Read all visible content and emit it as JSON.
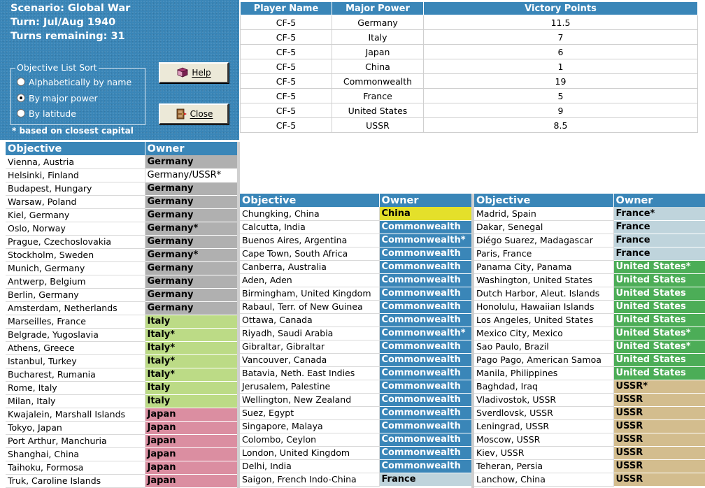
{
  "scenario": {
    "line1": "Scenario: Global War",
    "line2": "Turn: Jul/Aug 1940",
    "line3": "Turns remaining: 31"
  },
  "sort": {
    "legend": "Objective List Sort",
    "options": [
      "Alphabetically by name",
      "By major power",
      "By latitude"
    ],
    "selected": "By major power",
    "note": "* based on closest capital"
  },
  "buttons": {
    "help": "Help",
    "close": "Close"
  },
  "victory_table": {
    "headers": [
      "Player Name",
      "Major Power",
      "Victory Points"
    ],
    "rows": [
      [
        "CF-5",
        "Germany",
        "11.5"
      ],
      [
        "CF-5",
        "Italy",
        "7"
      ],
      [
        "CF-5",
        "Japan",
        "6"
      ],
      [
        "CF-5",
        "China",
        "1"
      ],
      [
        "CF-5",
        "Commonwealth",
        "19"
      ],
      [
        "CF-5",
        "France",
        "5"
      ],
      [
        "CF-5",
        "United States",
        "9"
      ],
      [
        "CF-5",
        "USSR",
        "8.5"
      ]
    ]
  },
  "objective_headers": {
    "objective": "Objective",
    "owner": "Owner"
  },
  "owner_colors": {
    "Germany": "#b0b0b0",
    "Italy": "#bcdb86",
    "Japan": "#db8ea1",
    "China": "#e4e02a",
    "Commonwealth": "#3a86b8",
    "France": "#bfd4dc",
    "United States": "#4cad57",
    "USSR": "#d3bd8e"
  },
  "objectives_left": [
    {
      "name": "Vienna, Austria",
      "owner": "Germany",
      "cls": "o-germany"
    },
    {
      "name": "Helsinki, Finland",
      "owner": "Germany/USSR*",
      "cls": "o-plain"
    },
    {
      "name": "Budapest, Hungary",
      "owner": "Germany",
      "cls": "o-germany"
    },
    {
      "name": "Warsaw, Poland",
      "owner": "Germany",
      "cls": "o-germany"
    },
    {
      "name": "Kiel, Germany",
      "owner": "Germany",
      "cls": "o-germany"
    },
    {
      "name": "Oslo, Norway",
      "owner": "Germany*",
      "cls": "o-germany"
    },
    {
      "name": "Prague, Czechoslovakia",
      "owner": "Germany",
      "cls": "o-germany"
    },
    {
      "name": "Stockholm, Sweden",
      "owner": "Germany*",
      "cls": "o-germany"
    },
    {
      "name": "Munich, Germany",
      "owner": "Germany",
      "cls": "o-germany"
    },
    {
      "name": "Antwerp, Belgium",
      "owner": "Germany",
      "cls": "o-germany"
    },
    {
      "name": "Berlin, Germany",
      "owner": "Germany",
      "cls": "o-germany"
    },
    {
      "name": "Amsterdam, Netherlands",
      "owner": "Germany",
      "cls": "o-germany"
    },
    {
      "name": "Marseilles, France",
      "owner": "Italy",
      "cls": "o-italy"
    },
    {
      "name": "Belgrade, Yugoslavia",
      "owner": "Italy*",
      "cls": "o-italy"
    },
    {
      "name": "Athens, Greece",
      "owner": "Italy*",
      "cls": "o-italy"
    },
    {
      "name": "Istanbul, Turkey",
      "owner": "Italy*",
      "cls": "o-italy"
    },
    {
      "name": "Bucharest, Rumania",
      "owner": "Italy*",
      "cls": "o-italy"
    },
    {
      "name": "Rome, Italy",
      "owner": "Italy",
      "cls": "o-italy"
    },
    {
      "name": "Milan, Italy",
      "owner": "Italy",
      "cls": "o-italy"
    },
    {
      "name": "Kwajalein, Marshall Islands",
      "owner": "Japan",
      "cls": "o-japan"
    },
    {
      "name": "Tokyo, Japan",
      "owner": "Japan",
      "cls": "o-japan"
    },
    {
      "name": "Port Arthur, Manchuria",
      "owner": "Japan",
      "cls": "o-japan"
    },
    {
      "name": "Shanghai, China",
      "owner": "Japan",
      "cls": "o-japan"
    },
    {
      "name": "Taihoku, Formosa",
      "owner": "Japan",
      "cls": "o-japan"
    },
    {
      "name": "Truk, Caroline Islands",
      "owner": "Japan",
      "cls": "o-japan"
    }
  ],
  "objectives_middle": [
    {
      "name": "Chungking, China",
      "owner": "China",
      "cls": "o-china"
    },
    {
      "name": "Calcutta, India",
      "owner": "Commonwealth",
      "cls": "o-cw"
    },
    {
      "name": "Buenos Aires, Argentina",
      "owner": "Commonwealth*",
      "cls": "o-cw"
    },
    {
      "name": "Cape Town, South Africa",
      "owner": "Commonwealth",
      "cls": "o-cw"
    },
    {
      "name": "Canberra, Australia",
      "owner": "Commonwealth",
      "cls": "o-cw"
    },
    {
      "name": "Aden, Aden",
      "owner": "Commonwealth",
      "cls": "o-cw"
    },
    {
      "name": "Birmingham, United Kingdom",
      "owner": "Commonwealth",
      "cls": "o-cw"
    },
    {
      "name": "Rabaul, Terr. of New Guinea",
      "owner": "Commonwealth",
      "cls": "o-cw"
    },
    {
      "name": "Ottawa, Canada",
      "owner": "Commonwealth",
      "cls": "o-cw"
    },
    {
      "name": "Riyadh, Saudi Arabia",
      "owner": "Commonwealth*",
      "cls": "o-cw"
    },
    {
      "name": "Gibraltar, Gibraltar",
      "owner": "Commonwealth",
      "cls": "o-cw"
    },
    {
      "name": "Vancouver, Canada",
      "owner": "Commonwealth",
      "cls": "o-cw"
    },
    {
      "name": "Batavia, Neth. East Indies",
      "owner": "Commonwealth",
      "cls": "o-cw"
    },
    {
      "name": "Jerusalem, Palestine",
      "owner": "Commonwealth",
      "cls": "o-cw"
    },
    {
      "name": "Wellington, New Zealand",
      "owner": "Commonwealth",
      "cls": "o-cw"
    },
    {
      "name": "Suez, Egypt",
      "owner": "Commonwealth",
      "cls": "o-cw"
    },
    {
      "name": "Singapore, Malaya",
      "owner": "Commonwealth",
      "cls": "o-cw"
    },
    {
      "name": "Colombo, Ceylon",
      "owner": "Commonwealth",
      "cls": "o-cw"
    },
    {
      "name": "London, United Kingdom",
      "owner": "Commonwealth",
      "cls": "o-cw"
    },
    {
      "name": "Delhi, India",
      "owner": "Commonwealth",
      "cls": "o-cw"
    },
    {
      "name": "Saigon, French Indo-China",
      "owner": "France",
      "cls": "o-france"
    }
  ],
  "objectives_right": [
    {
      "name": "Madrid, Spain",
      "owner": "France*",
      "cls": "o-france"
    },
    {
      "name": "Dakar, Senegal",
      "owner": "France",
      "cls": "o-france"
    },
    {
      "name": "Diégo Suarez, Madagascar",
      "owner": "France",
      "cls": "o-france"
    },
    {
      "name": "Paris, France",
      "owner": "France",
      "cls": "o-france"
    },
    {
      "name": "Panama City, Panama",
      "owner": "United States*",
      "cls": "o-us"
    },
    {
      "name": "Washington, United States",
      "owner": "United States",
      "cls": "o-us"
    },
    {
      "name": "Dutch Harbor, Aleut. Islands",
      "owner": "United States",
      "cls": "o-us"
    },
    {
      "name": "Honolulu, Hawaiian Islands",
      "owner": "United States",
      "cls": "o-us"
    },
    {
      "name": "Los Angeles, United States",
      "owner": "United States",
      "cls": "o-us"
    },
    {
      "name": "Mexico City, Mexico",
      "owner": "United States*",
      "cls": "o-us"
    },
    {
      "name": "Sao Paulo, Brazil",
      "owner": "United States*",
      "cls": "o-us"
    },
    {
      "name": "Pago Pago, American Samoa",
      "owner": "United States",
      "cls": "o-us"
    },
    {
      "name": "Manila, Philippines",
      "owner": "United States",
      "cls": "o-us"
    },
    {
      "name": "Baghdad, Iraq",
      "owner": "USSR*",
      "cls": "o-ussr"
    },
    {
      "name": "Vladivostok, USSR",
      "owner": "USSR",
      "cls": "o-ussr"
    },
    {
      "name": "Sverdlovsk, USSR",
      "owner": "USSR",
      "cls": "o-ussr"
    },
    {
      "name": "Leningrad, USSR",
      "owner": "USSR",
      "cls": "o-ussr"
    },
    {
      "name": "Moscow, USSR",
      "owner": "USSR",
      "cls": "o-ussr"
    },
    {
      "name": "Kiev, USSR",
      "owner": "USSR",
      "cls": "o-ussr"
    },
    {
      "name": "Teheran, Persia",
      "owner": "USSR",
      "cls": "o-ussr"
    },
    {
      "name": "Lanchow, China",
      "owner": "USSR",
      "cls": "o-ussr"
    }
  ]
}
